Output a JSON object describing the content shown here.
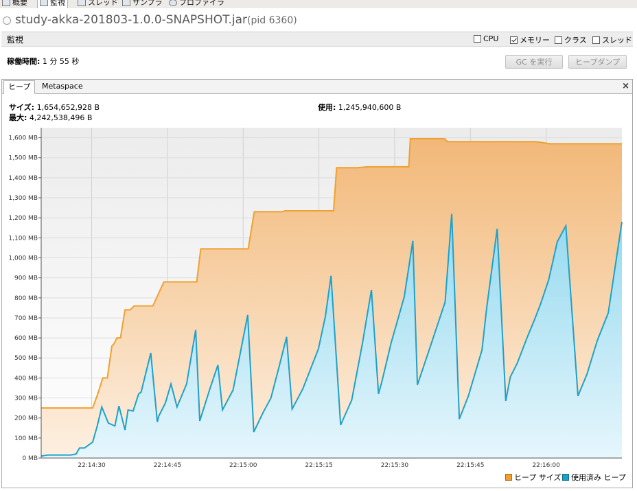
{
  "top_tabs": [
    {
      "label": "概要",
      "icon": "overview-icon"
    },
    {
      "label": "監視",
      "icon": "monitor-icon"
    },
    {
      "label": "スレッド",
      "icon": "threads-icon"
    },
    {
      "label": "サンプラ",
      "icon": "sampler-icon"
    },
    {
      "label": "プロファイラ",
      "icon": "profiler-icon"
    }
  ],
  "title": {
    "app": "study-akka-201803-1.0.0-SNAPSHOT.jar",
    "pid": "(pid 6360)"
  },
  "monitor": {
    "label": "監視",
    "checks": [
      {
        "label": "CPU",
        "checked": false
      },
      {
        "label": "メモリー",
        "checked": true
      },
      {
        "label": "クラス",
        "checked": false
      },
      {
        "label": "スレッド",
        "checked": false
      }
    ],
    "uptime_label": "稼働時間:",
    "uptime_value": "1 分 55 秒",
    "gc_button": "GC を実行",
    "heapdump_button": "ヒープダンプ"
  },
  "panel_tabs": {
    "heap": "ヒープ",
    "metaspace": "Metaspace",
    "close": "×"
  },
  "heap_info": {
    "size_label": "サイズ:",
    "size_value": "1,654,652,928 B",
    "max_label": "最大:",
    "max_value": "4,242,538,496 B",
    "used_label": "使用:",
    "used_value": "1,245,940,600 B"
  },
  "chart_data": {
    "type": "area",
    "xlim": [
      0,
      115
    ],
    "ylim": [
      0,
      1650
    ],
    "y_ticks": [
      0,
      100,
      200,
      300,
      400,
      500,
      600,
      700,
      800,
      900,
      1000,
      1100,
      1200,
      1300,
      1400,
      1500,
      1600
    ],
    "y_tick_labels": [
      "0 MB",
      "100 MB",
      "200 MB",
      "300 MB",
      "400 MB",
      "500 MB",
      "600 MB",
      "700 MB",
      "800 MB",
      "900 MB",
      "1,000 MB",
      "1,100 MB",
      "1,200 MB",
      "1,300 MB",
      "1,400 MB",
      "1,500 MB",
      "1,600 MB"
    ],
    "x_ticks": [
      10,
      25,
      40,
      55,
      70,
      85,
      100
    ],
    "x_tick_labels": [
      "22:14:30",
      "22:14:45",
      "22:15:00",
      "22:15:15",
      "22:15:30",
      "22:15:45",
      "22:16:00"
    ],
    "colors": {
      "heap": "#f0a030",
      "used": "#1fa0c8"
    },
    "series": [
      {
        "name": "ヒープ サイズ",
        "x": [
          0,
          10.2,
          11.2,
          12.2,
          13.1,
          14,
          14.4,
          15,
          15.7,
          16.6,
          17.6,
          18.4,
          20.5,
          22.1,
          22.3,
          24.3,
          26.6,
          30.8,
          31.6,
          36.4,
          41,
          42.2,
          47.5,
          48.3,
          53.1,
          56.3,
          57.9,
          58.5,
          62.7,
          64.6,
          70.5,
          72.8,
          73.1,
          77.3,
          79.9,
          80.4,
          87.4,
          98,
          100.8,
          115
        ],
        "y": [
          250,
          250,
          320,
          400,
          400,
          560,
          570,
          600,
          600,
          740,
          740,
          760,
          760,
          760,
          770,
          880,
          880,
          880,
          1045,
          1045,
          1045,
          1230,
          1230,
          1235,
          1235,
          1235,
          1235,
          1450,
          1450,
          1455,
          1455,
          1455,
          1595,
          1595,
          1595,
          1580,
          1580,
          1580,
          1570,
          1570
        ]
      },
      {
        "name": "使用済み ヒープ",
        "x": [
          0,
          1.3,
          5.9,
          6.9,
          7.6,
          8.6,
          10.2,
          11.1,
          12,
          13.3,
          14.6,
          15.4,
          16.6,
          17.2,
          18.2,
          19.3,
          19.8,
          21.7,
          23,
          23.3,
          24.6,
          25.7,
          26.9,
          28.8,
          30.6,
          31.4,
          33.4,
          35,
          35.9,
          38,
          40.9,
          42.1,
          44,
          45.5,
          47.1,
          48.6,
          49.7,
          51.8,
          54.9,
          56.3,
          57.4,
          59.3,
          61.5,
          63.6,
          65.4,
          66.8,
          67.5,
          69.3,
          71.9,
          73.6,
          74.5,
          77.1,
          80,
          81.3,
          82.8,
          84.6,
          87.3,
          88.2,
          90.3,
          92,
          92.9,
          94.3,
          96.2,
          97.6,
          98.9,
          100.5,
          102.2,
          103.9,
          106.3,
          108.1,
          110.1,
          112.3,
          115
        ],
        "y": [
          10,
          15,
          15,
          20,
          50,
          50,
          80,
          160,
          255,
          175,
          160,
          260,
          140,
          240,
          235,
          320,
          330,
          525,
          180,
          210,
          275,
          370,
          255,
          370,
          640,
          185,
          345,
          465,
          240,
          340,
          715,
          130,
          230,
          300,
          455,
          605,
          245,
          345,
          545,
          710,
          910,
          165,
          290,
          570,
          840,
          320,
          385,
          575,
          805,
          1085,
          365,
          560,
          780,
          1220,
          195,
          310,
          540,
          745,
          1145,
          285,
          405,
          475,
          600,
          685,
          770,
          890,
          1080,
          1160,
          310,
          420,
          585,
          725,
          1180
        ]
      }
    ]
  }
}
